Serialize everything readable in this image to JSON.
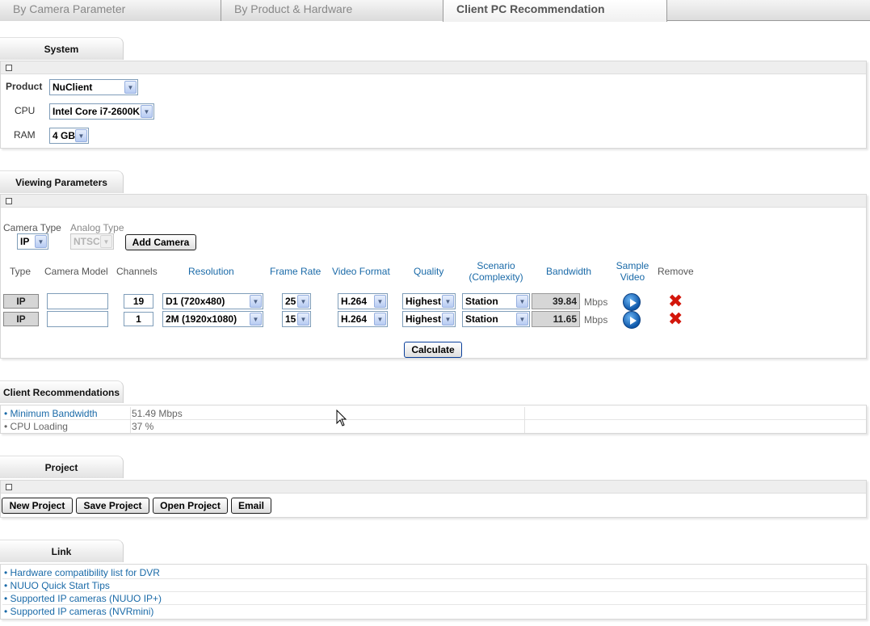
{
  "tabs": [
    {
      "label": "By Camera Parameter"
    },
    {
      "label": "By Product & Hardware"
    },
    {
      "label": "Client PC Recommendation"
    }
  ],
  "system": {
    "title": "System",
    "product_label": "Product",
    "product_value": "NuClient",
    "cpu_label": "CPU",
    "cpu_value": "Intel Core i7-2600K",
    "ram_label": "RAM",
    "ram_value": "4 GB"
  },
  "viewing": {
    "title": "Viewing Parameters",
    "camera_type_label": "Camera Type",
    "camera_type_value": "IP",
    "analog_type_label": "Analog Type",
    "analog_type_value": "NTSC",
    "add_camera": "Add Camera",
    "headers": {
      "type": "Type",
      "camera_model": "Camera Model",
      "channels": "Channels",
      "resolution": "Resolution",
      "frame_rate": "Frame Rate",
      "video_format": "Video Format",
      "quality": "Quality",
      "scenario_1": "Scenario",
      "scenario_2": "(Complexity)",
      "bandwidth": "Bandwidth",
      "sample_1": "Sample",
      "sample_2": "Video",
      "remove": "Remove"
    },
    "rows": [
      {
        "type": "IP",
        "model": "",
        "channels": "19",
        "resolution": "D1 (720x480)",
        "frame_rate": "25",
        "video_format": "H.264",
        "quality": "Highest",
        "scenario": "Station",
        "bandwidth": "39.84",
        "unit": "Mbps"
      },
      {
        "type": "IP",
        "model": "",
        "channels": "1",
        "resolution": "2M (1920x1080)",
        "frame_rate": "15",
        "video_format": "H.264",
        "quality": "Highest",
        "scenario": "Station",
        "bandwidth": "11.65",
        "unit": "Mbps"
      }
    ],
    "calculate": "Calculate"
  },
  "recommendations": {
    "title": "Client Recommendations",
    "items": [
      {
        "label": "• Minimum Bandwidth",
        "value": "51.49 Mbps"
      },
      {
        "label": "• CPU Loading",
        "value": "37 %"
      }
    ]
  },
  "project": {
    "title": "Project",
    "buttons": {
      "new": "New Project",
      "save": "Save Project",
      "open": "Open Project",
      "email": "Email"
    }
  },
  "links": {
    "title": "Link",
    "items": [
      "• Hardware compatibility list for DVR",
      "• NUUO Quick Start Tips",
      "• Supported IP cameras (NUUO IP+)",
      "• Supported IP cameras (NVRmini)"
    ]
  },
  "icons": {
    "play": "play-icon",
    "remove": "remove-x-icon",
    "collapse": "collapse-box-icon",
    "dropdown": "chevron-down-icon"
  },
  "colors": {
    "link": "#1a6aa8",
    "remove": "#d3160b",
    "play": "#0d56a8"
  }
}
